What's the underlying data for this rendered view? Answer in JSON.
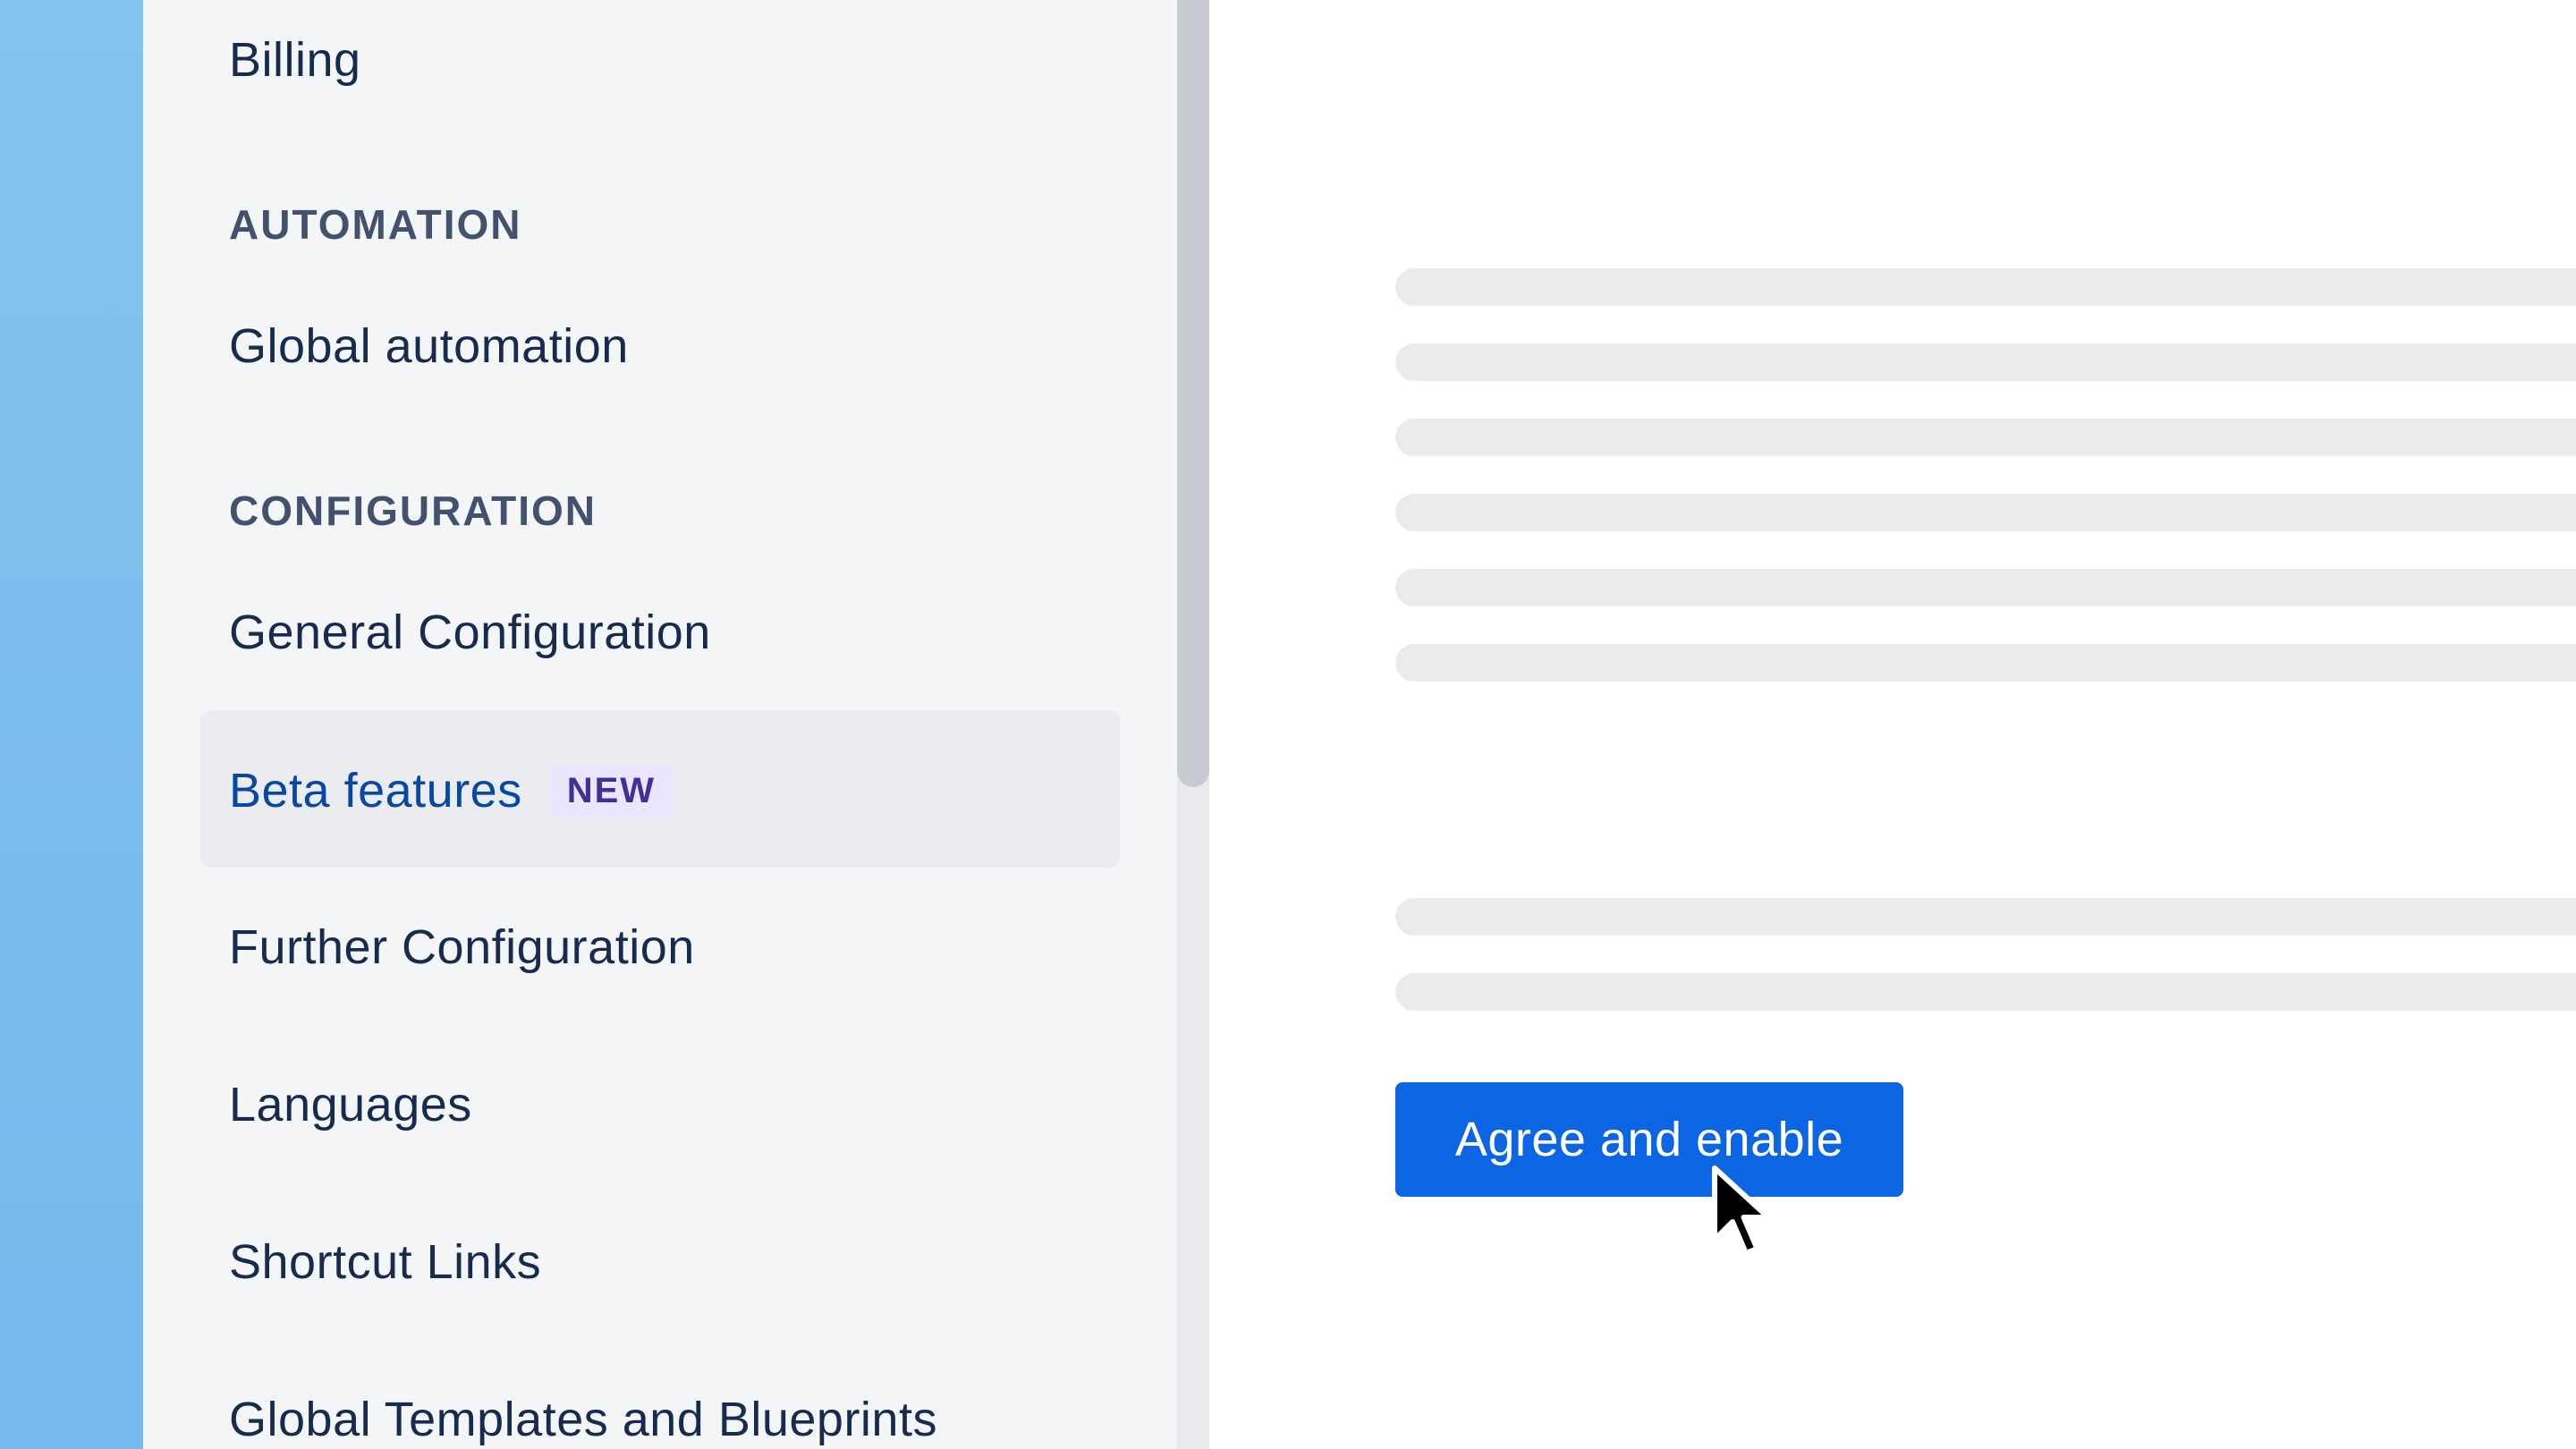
{
  "sidebar": {
    "items": {
      "billing": "Billing",
      "automation_heading": "AUTOMATION",
      "global_automation": "Global automation",
      "configuration_heading": "CONFIGURATION",
      "general_configuration": "General Configuration",
      "beta_features": "Beta features",
      "beta_badge": "NEW",
      "further_configuration": "Further Configuration",
      "languages": "Languages",
      "shortcut_links": "Shortcut Links",
      "global_templates": "Global Templates and Blueprints"
    },
    "active_item": "Beta features"
  },
  "main": {
    "agree_button_label": "Agree and enable",
    "skeleton_line_count": 8
  },
  "colors": {
    "accent": "#0c66e4",
    "active_text": "#0747a6",
    "badge_bg": "#eae6ff",
    "badge_text": "#403294",
    "sidebar_bg": "#f4f5f7",
    "skeleton": "#ebebeb"
  },
  "icons": {
    "cursor": "mouse-pointer-icon"
  }
}
